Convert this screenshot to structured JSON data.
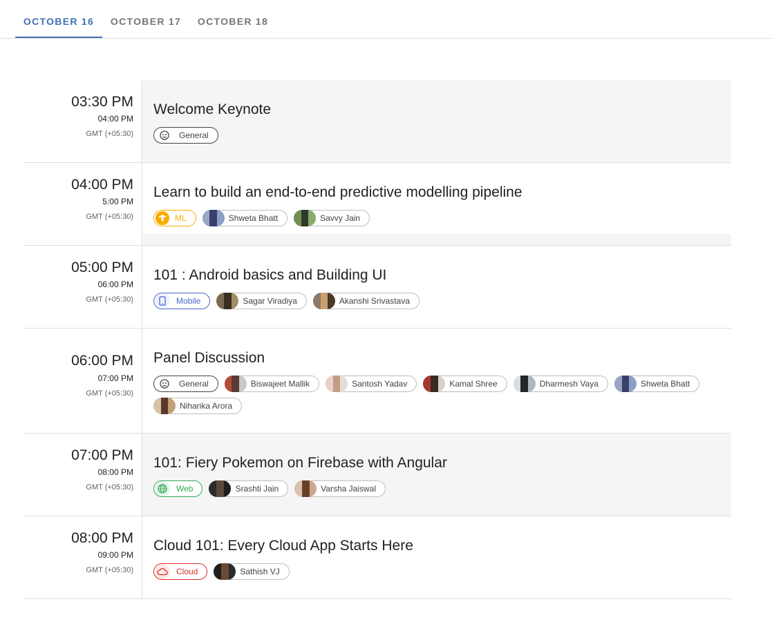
{
  "tabs": [
    {
      "label": "OCTOBER 16",
      "active": true
    },
    {
      "label": "OCTOBER 17",
      "active": false
    },
    {
      "label": "OCTOBER 18",
      "active": false
    }
  ],
  "sessions": [
    {
      "start": "03:30 PM",
      "end": "04:00 PM",
      "timezone": "GMT (+05:30)",
      "title": "Welcome Keynote",
      "tag": {
        "label": "General",
        "icon": "general-icon",
        "color": "#424242"
      },
      "speakers": []
    },
    {
      "start": "04:00 PM",
      "end": "5:00 PM",
      "timezone": "GMT (+05:30)",
      "title": "Learn to build an end-to-end predictive modelling pipeline",
      "tag": {
        "label": "ML",
        "icon": "tensorflow-icon",
        "color": "#f9ab00"
      },
      "speakers": [
        "Shweta Bhatt",
        "Savvy Jain"
      ]
    },
    {
      "start": "05:00 PM",
      "end": "06:00 PM",
      "timezone": "GMT (+05:30)",
      "title": "101 : Android basics and Building UI",
      "tag": {
        "label": "Mobile",
        "icon": "mobile-icon",
        "color": "#4a67c9"
      },
      "speakers": [
        "Sagar Viradiya",
        "Akanshi Srivastava"
      ]
    },
    {
      "start": "06:00 PM",
      "end": "07:00 PM",
      "timezone": "GMT (+05:30)",
      "title": "Panel Discussion",
      "tag": {
        "label": "General",
        "icon": "general-icon",
        "color": "#424242"
      },
      "speakers": [
        "Biswajeet Mallik",
        "Santosh Yadav",
        "Kamal Shree",
        "Dharmesh Vaya",
        "Shweta Bhatt",
        "Niharika Arora"
      ]
    },
    {
      "start": "07:00 PM",
      "end": "08:00 PM",
      "timezone": "GMT (+05:30)",
      "title": "101: Fiery Pokemon on Firebase with Angular",
      "tag": {
        "label": "Web",
        "icon": "globe-icon",
        "color": "#34a853"
      },
      "speakers": [
        "Srashti Jain",
        "Varsha Jaiswal"
      ]
    },
    {
      "start": "08:00 PM",
      "end": "09:00 PM",
      "timezone": "GMT (+05:30)",
      "title": "Cloud 101: Every Cloud App Starts Here",
      "tag": {
        "label": "Cloud",
        "icon": "cloud-icon",
        "color": "#d93025"
      },
      "speakers": [
        "Sathish VJ"
      ]
    }
  ]
}
